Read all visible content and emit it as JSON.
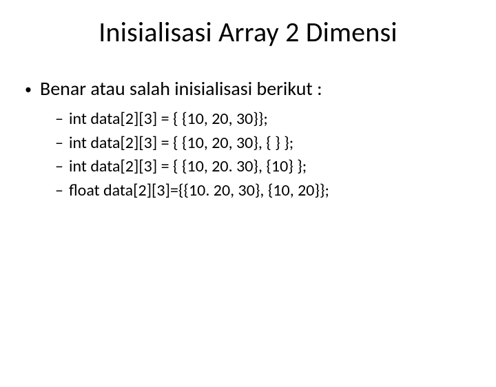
{
  "title": "Inisialisasi Array 2 Dimensi",
  "bullet": {
    "text": "Benar atau salah inisialisasi berikut :",
    "subitems": [
      "int data[2][3] = { {10, 20, 30}};",
      "int data[2][3] = { {10, 20, 30}, { } };",
      "int data[2][3] = { {10, 20. 30}, {10} };",
      "float data[2][3]={{10. 20, 30}, {10, 20}};"
    ]
  }
}
